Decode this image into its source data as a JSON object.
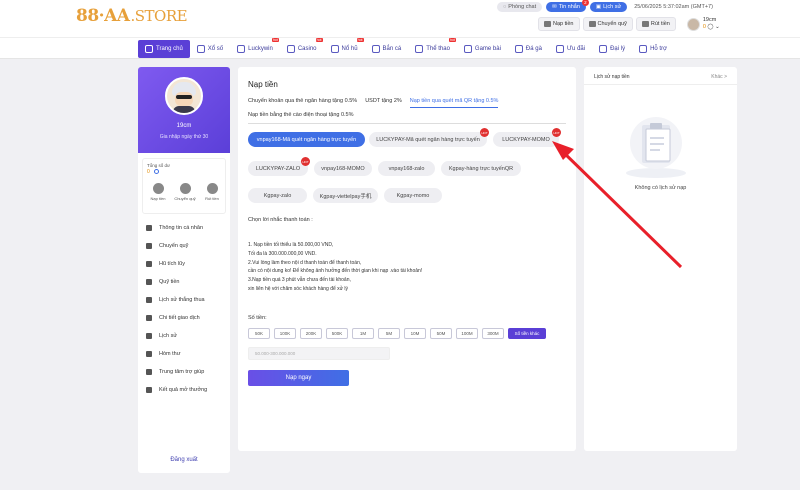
{
  "brand": {
    "name": "88·AA",
    "suffix": ".STORE"
  },
  "topbar": {
    "chat_label": "Phòng chat",
    "inbox_label": "Tin nhắn",
    "inbox_badge": "2",
    "history_label": "Lịch sử",
    "datetime": "25/06/2025 5:37:02am",
    "timezone": "(GMT+7)",
    "deposit_label": "Nạp tiền",
    "transfer_label": "Chuyển quỹ",
    "withdraw_label": "Rút tiền",
    "username": "19cm",
    "balance": "0"
  },
  "nav": {
    "items": [
      {
        "label": "Trang chủ",
        "hot": ""
      },
      {
        "label": "Xổ số",
        "hot": ""
      },
      {
        "label": "Luckywin",
        "hot": "hot"
      },
      {
        "label": "Casino",
        "hot": "hot"
      },
      {
        "label": "Nổ hũ",
        "hot": "hot"
      },
      {
        "label": "Bắn cá",
        "hot": ""
      },
      {
        "label": "Thể thao",
        "hot": "hot"
      },
      {
        "label": "Game bài",
        "hot": ""
      },
      {
        "label": "Đá gà",
        "hot": ""
      },
      {
        "label": "Ưu đãi",
        "hot": ""
      },
      {
        "label": "Đại lý",
        "hot": ""
      },
      {
        "label": "Hỗ trợ",
        "hot": ""
      }
    ]
  },
  "profile": {
    "name": "19cm",
    "subtitle": "Gia nhập ngày thứ 30",
    "wallet_label": "Tổng số dư",
    "wallet_value": "0",
    "deposit": "Nạp tiền",
    "transfer": "Chuyển quỹ",
    "withdraw": "Rút tiền"
  },
  "menu": [
    "Thông tin cá nhân",
    "Chuyển quỹ",
    "Hũ tích lũy",
    "Quỹ tiền",
    "Lịch sử thắng thua",
    "Chi tiết giao dịch",
    "Lịch sử",
    "Hòm thư",
    "Trung tâm trợ giúp",
    "Kết quả mở thưởng"
  ],
  "logout": "Đăng xuất",
  "main": {
    "title": "Nạp tiền",
    "tabs": [
      "Chuyển khoản qua thẻ ngân hàng tặng 0.5%",
      "USDT tặng 2%",
      "Nạp tiền qua quét mã QR tặng 0.5%"
    ],
    "tab2": "Nạp tiền bằng thẻ cào điện thoại tặng 0.5%",
    "channels": [
      "vnpay168-Mã quét ngân hàng trực tuyến",
      "LUCKYPAY-Mã quét ngân hàng trực tuyến",
      "LUCKYPAY-MOMO",
      "LUCKYPAY-ZALO",
      "vnpay168-MOMO",
      "vnpay168-zalo",
      "Kgpay-hàng trực tuyếnQR",
      "Kgpay-zalo",
      "Kgpay-viettelpay手机",
      "Kgpay-momo"
    ],
    "hot_label": "HOT",
    "notice_title": "Chọn lời nhắc thanh toán :",
    "notice_lines": [
      "1. Nạp tiền tối thiểu là 50.000,00 VND,",
      "Tối đa là 300.000.000,00 VND.",
      "2.Vui lòng làm theo nội d thanh toán để thanh toán,",
      "cần có nội dung ko! Để không ảnh hưởng đến thời gian khi nạp .vào tài khoản!",
      "3.Nạp tiền quá 3 phút vẫn chưa đến tài khoản,",
      "xin liên hệ với chăm sóc khách hàng để xử lý"
    ],
    "amount_label": "Số tiền:",
    "amounts": [
      "50K",
      "100K",
      "200K",
      "500K",
      "1M",
      "5M",
      "10M",
      "50M",
      "100M",
      "300M"
    ],
    "amount_other": "Số tiền khác",
    "amount_placeholder": "50.000-300.000.000",
    "submit": "Nạp ngay"
  },
  "history": {
    "title": "Lịch sử nạp tiền",
    "more": "Khác >",
    "empty": "Không có lịch sử nạp"
  },
  "colors": {
    "accent": "#5a3fd6",
    "blue": "#3f6fe5",
    "arrow": "#e8202a",
    "hot": "#e03030"
  }
}
